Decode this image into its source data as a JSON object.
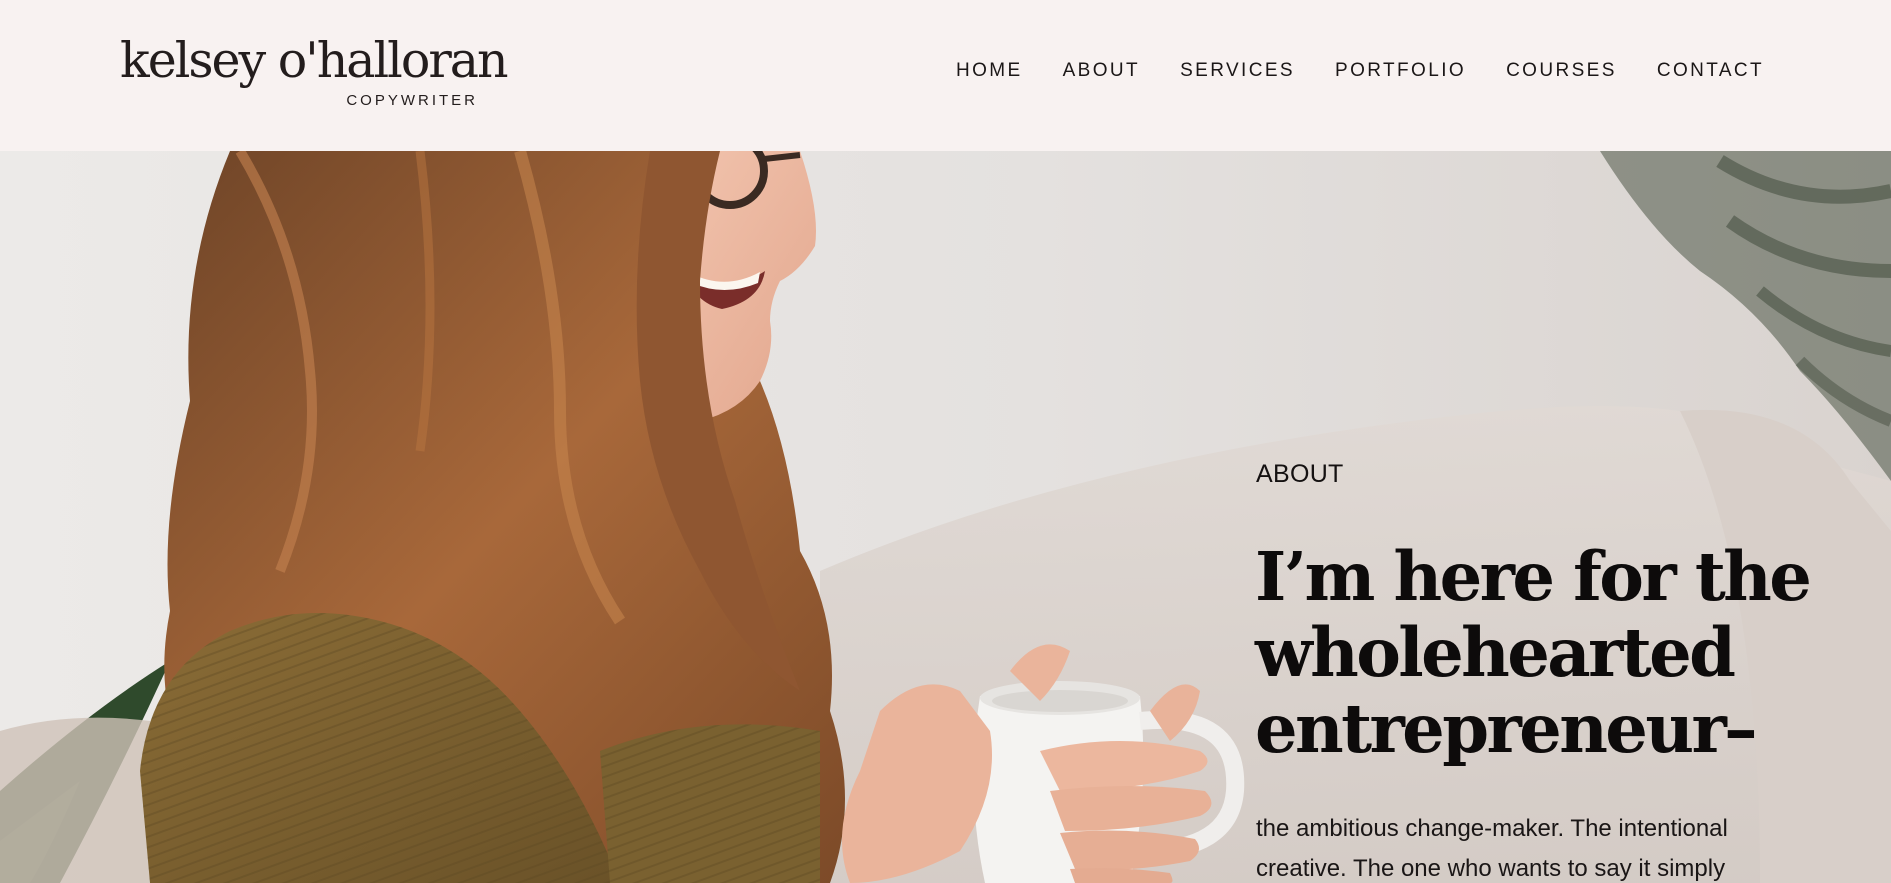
{
  "header": {
    "logo": {
      "name": "kelsey o'halloran",
      "tagline": "COPYWRITER"
    },
    "nav": [
      {
        "label": "HOME"
      },
      {
        "label": "ABOUT"
      },
      {
        "label": "SERVICES"
      },
      {
        "label": "PORTFOLIO"
      },
      {
        "label": "COURSES"
      },
      {
        "label": "CONTACT"
      }
    ]
  },
  "hero": {
    "section_label": "ABOUT",
    "headline": "I’m here for the wholehearted entrepreneur–",
    "intro": "the ambitious change-maker. The intentional creative. The one who wants to say it simply"
  },
  "colors": {
    "header_bg": "#f8f2f1",
    "text_dark": "#0d0b0b",
    "sweater": "#7a6130",
    "hair": "#9c5f33"
  }
}
